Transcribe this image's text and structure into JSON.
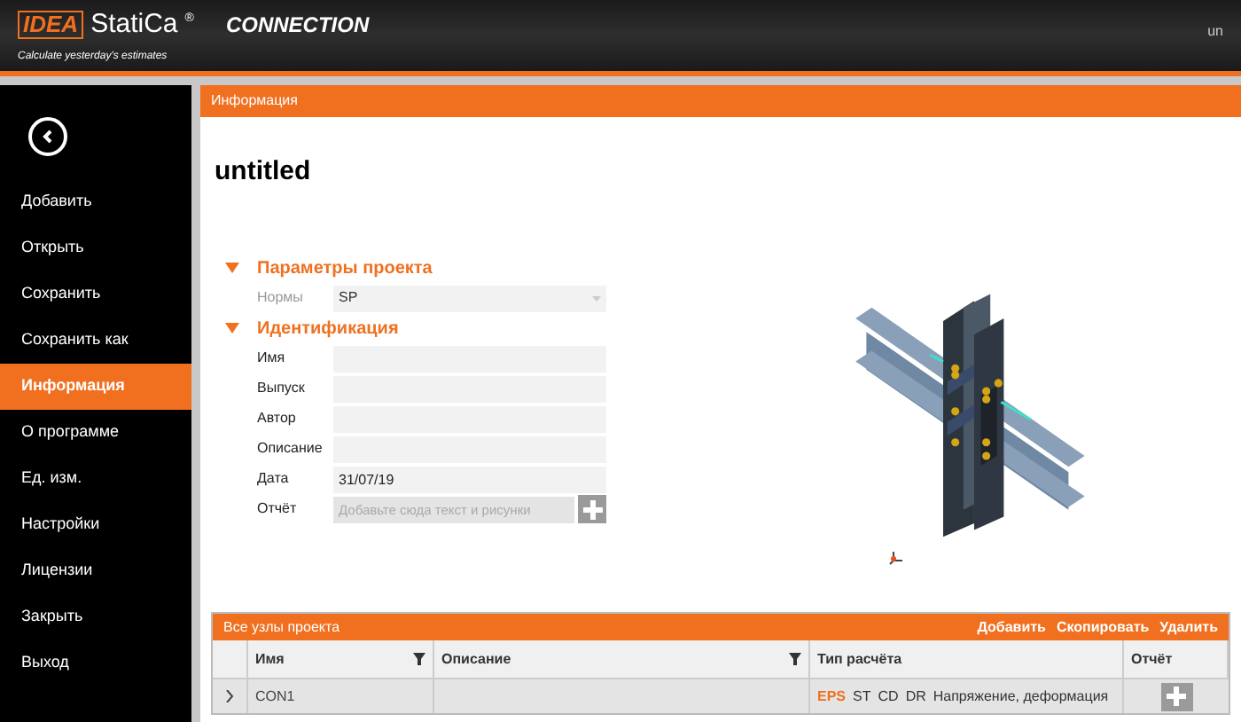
{
  "header": {
    "logo_mark": "IDEA",
    "product": "StatiCa",
    "registered": "®",
    "module": "CONNECTION",
    "tagline": "Calculate yesterday's estimates",
    "document_title": "un"
  },
  "sidebar": {
    "items": [
      {
        "label": "Добавить",
        "selected": false
      },
      {
        "label": "Открыть",
        "selected": false
      },
      {
        "label": "Сохранить",
        "selected": false
      },
      {
        "label": "Сохранить как",
        "selected": false
      },
      {
        "label": "Информация",
        "selected": true
      },
      {
        "label": "О программе",
        "selected": false
      },
      {
        "label": "Ед. изм.",
        "selected": false
      },
      {
        "label": "Настройки",
        "selected": false
      },
      {
        "label": "Лицензии",
        "selected": false
      },
      {
        "label": "Закрыть",
        "selected": false
      },
      {
        "label": "Выход",
        "selected": false
      }
    ]
  },
  "page": {
    "section_bar": "Информация",
    "title": "untitled",
    "sections": [
      {
        "title": "Параметры проекта",
        "expanded": true,
        "fields": [
          {
            "kind": "select",
            "label": "Нормы",
            "value": "SP",
            "disabled": true
          }
        ]
      },
      {
        "title": "Идентификация",
        "expanded": true,
        "fields": [
          {
            "kind": "text",
            "label": "Имя",
            "disabled": false
          },
          {
            "kind": "text",
            "label": "Выпуск",
            "disabled": false
          },
          {
            "kind": "text",
            "label": "Автор",
            "disabled": false
          },
          {
            "kind": "text",
            "label": "Описание",
            "disabled": false
          },
          {
            "kind": "text",
            "label": "Дата",
            "value": "31/07/19",
            "disabled": false
          },
          {
            "kind": "report",
            "label": "Отчёт",
            "placeholder": "Добавьте сюда текст и рисунки",
            "disabled": false
          }
        ]
      }
    ]
  },
  "table": {
    "title": "Все узлы проекта",
    "actions": [
      "Добавить",
      "Скопировать",
      "Удалить"
    ],
    "columns": [
      {
        "label": "Имя",
        "filter": true
      },
      {
        "label": "Описание",
        "filter": true
      },
      {
        "label": "Тип расчёта",
        "filter": false
      },
      {
        "label": "Отчёт",
        "filter": false
      }
    ],
    "rows": [
      {
        "expanded": false,
        "name": "CON1",
        "analysis_types": [
          {
            "label": "EPS",
            "active": true
          },
          {
            "label": "ST",
            "active": false
          },
          {
            "label": "CD",
            "active": false
          },
          {
            "label": "DR",
            "active": false
          }
        ],
        "analysis_name": "Напряжение, деформация"
      }
    ]
  }
}
